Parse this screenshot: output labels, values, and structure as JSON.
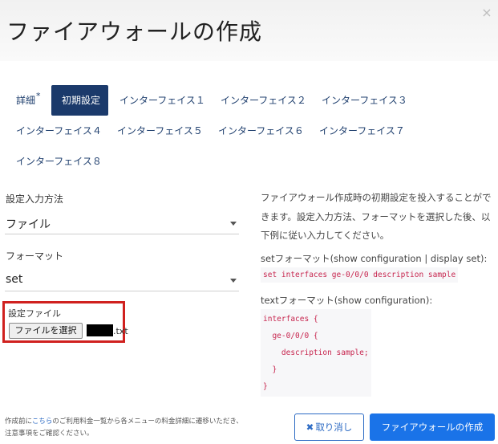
{
  "modal": {
    "title": "ファイアウォールの作成",
    "close_icon": "×"
  },
  "tabs": [
    {
      "label": "詳細",
      "marker": "*",
      "active": false
    },
    {
      "label": "初期設定",
      "active": true
    },
    {
      "label": "インターフェイス１",
      "active": false
    },
    {
      "label": "インターフェイス２",
      "active": false
    },
    {
      "label": "インターフェイス３",
      "active": false
    },
    {
      "label": "インターフェイス４",
      "active": false
    },
    {
      "label": "インターフェイス５",
      "active": false
    },
    {
      "label": "インターフェイス６",
      "active": false
    },
    {
      "label": "インターフェイス７",
      "active": false
    },
    {
      "label": "インターフェイス８",
      "active": false
    }
  ],
  "form": {
    "input_method": {
      "label": "設定入力方法",
      "value": "ファイル"
    },
    "format": {
      "label": "フォーマット",
      "value": "set"
    },
    "config_file": {
      "label": "設定ファイル",
      "button_label": "ファイルを選択",
      "file_name_suffix": ".txt"
    }
  },
  "help": {
    "intro": [
      "ファイアウォール作成時の初期設定を投入することがで",
      "きます。設定入力方法、フォーマットを選択した後、以",
      "下例に従い入力してください。"
    ],
    "set_format_label": "setフォーマット(show configuration | display set):",
    "set_example": "set interfaces ge-0/0/0 description sample",
    "text_format_label": "textフォーマット(show configuration):",
    "text_example": "interfaces {\n  ge-0/0/0 {\n    description sample;\n  }\n}"
  },
  "footer": {
    "note_prefix": "作成前に",
    "note_link": "こちら",
    "note_suffix": "のご利用料金一覧から各メニューの料金詳細に遷移いただき、",
    "note_line2": "注意事項をご確認ください。",
    "cancel_icon": "✖",
    "cancel_label": "取り消し",
    "create_label": "ファイアウォールの作成"
  }
}
